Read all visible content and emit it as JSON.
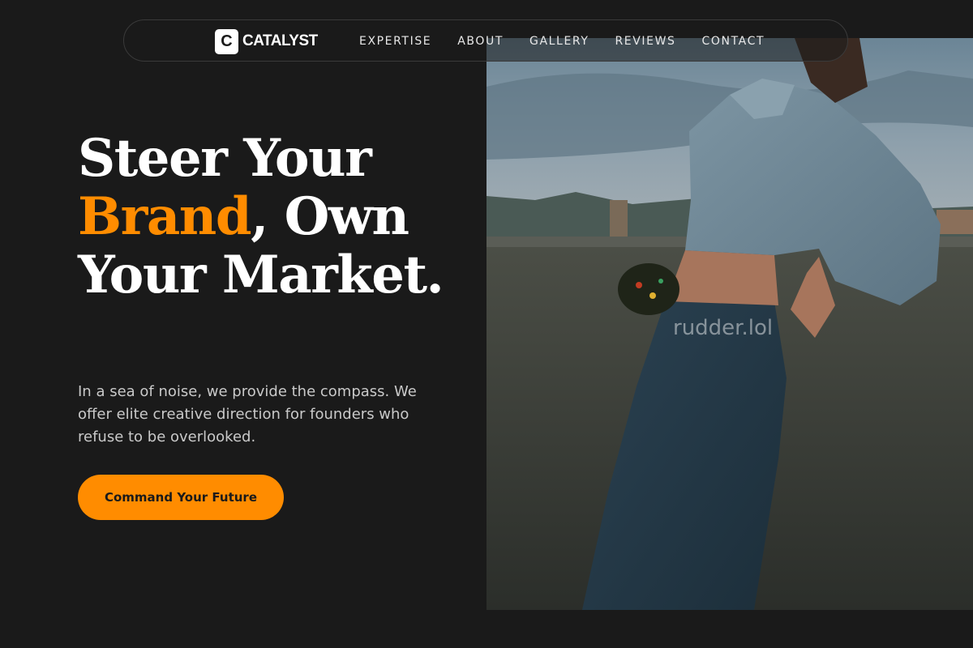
{
  "brand": {
    "mark": "C",
    "name": "CATALYST"
  },
  "nav": {
    "items": [
      {
        "label": "EXPERTISE"
      },
      {
        "label": "ABOUT"
      },
      {
        "label": "GALLERY"
      },
      {
        "label": "REVIEWS"
      },
      {
        "label": "CONTACT"
      }
    ]
  },
  "hero": {
    "headline_part1": "Steer Your ",
    "headline_accent": "Brand",
    "headline_part2": ", Own Your Market.",
    "subcopy": "In a sea of noise, we provide the compass. We offer elite creative direction for founders who refuse to be overlooked.",
    "cta_label": "Command Your Future",
    "image_watermark": "rudder.lol"
  },
  "colors": {
    "background": "#1a1a1a",
    "accent": "#ff8c00",
    "text": "#ffffff",
    "muted_text": "#c9c9c9"
  }
}
